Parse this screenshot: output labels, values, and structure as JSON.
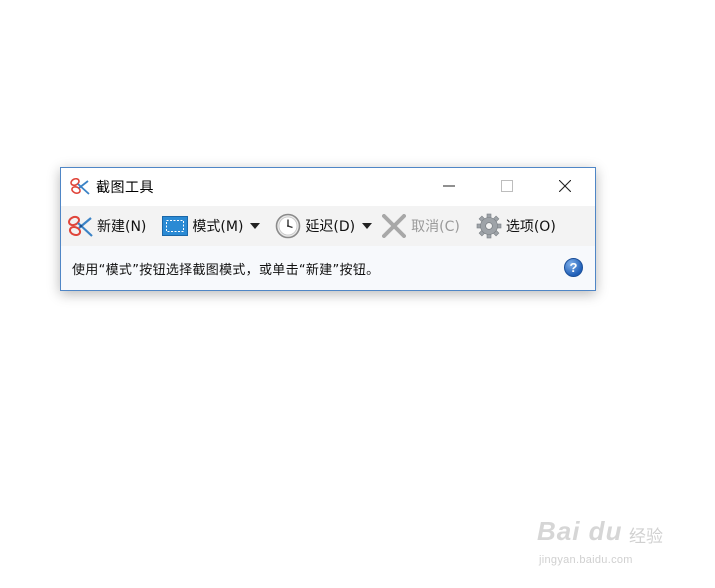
{
  "window": {
    "title": "截图工具",
    "controls": {
      "minimize": "minimize-icon",
      "maximize": "maximize-icon",
      "close": "close-icon"
    }
  },
  "toolbar": {
    "new_label": "新建(N)",
    "mode_label": "模式(M)",
    "delay_label": "延迟(D)",
    "cancel_label": "取消(C)",
    "options_label": "选项(O)"
  },
  "status": {
    "text": "使用“模式”按钮选择截图模式，或单击“新建”按钮。",
    "help": "?"
  },
  "watermark": {
    "brand": "Bai du",
    "product": "经验",
    "url": "jingyan.baidu.com"
  },
  "colors": {
    "window_border": "#4f86c6",
    "toolbar_bg": "#f3f3f3",
    "disabled_text": "#9a9a9a",
    "help_blue": "#2160b8"
  }
}
